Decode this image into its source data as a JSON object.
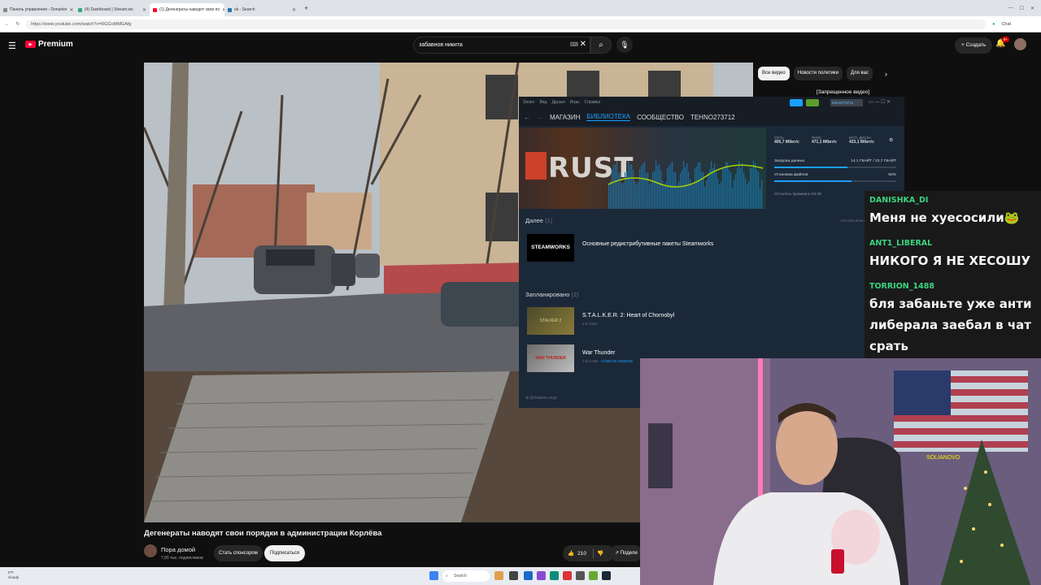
{
  "browser": {
    "tabs": [
      {
        "label": "Панель управления - Donation",
        "active": false
      },
      {
        "label": "(4) Dashboard | Stream.ws",
        "active": false
      },
      {
        "label": "(1) Дегенераты наводят свои по",
        "active": true
      },
      {
        "label": "ok - Search",
        "active": false
      }
    ],
    "new_tab": "+",
    "url": "https://www.youtube.com/watch?v=RGGo8tMGAfg",
    "profile": "Chat"
  },
  "youtube": {
    "logo_text": "Premium",
    "search_value": "забавнов никита",
    "create_label": "Создать",
    "notifications_count": "9+",
    "chips": [
      "Все видео",
      "Новости политики",
      "Для вас"
    ],
    "rec_item_title": "[Запрещенное видео]",
    "video_title": "Дегенераты наводят свои порядки в администрации Корлёва",
    "channel_name": "Пора домой",
    "channel_subs": "7,65 тыс. подписчиков",
    "sponsor_label": "Стать спонсором",
    "subscribe_label": "Подписаться",
    "like_count": "210",
    "share_label": "Подели"
  },
  "steam": {
    "menu": [
      "Steam",
      "Вид",
      "Друзья",
      "Игры",
      "Справка"
    ],
    "nav": [
      "МАГАЗИН",
      "БИБЛИОТЕКА",
      "СООБЩЕСТВО",
      "TEHNO273712"
    ],
    "active_nav": "БИБЛИОТЕКА",
    "username": "tehno273712",
    "banner_game": "RUST",
    "stats": {
      "net_label": "СЕТЬ",
      "net_value": "405,7 Мбит/с",
      "peak_label": "ПИКС",
      "peak_value": "471,1 Мбит/с",
      "disk_label": "ИСП. ДИСКА",
      "disk_value": "433,1 Мбит/с",
      "download_label": "Загрузка данных",
      "download_value": "14,1 ГБАЙТ / 23,7 ГБАЙТ",
      "install_label": "Установка файлов",
      "install_value": "63%",
      "remaining_label": "Осталось примерно 04:36",
      "download_progress": 0.6,
      "install_progress": 0.63
    },
    "section_next": "Далее",
    "section_next_count": "(1)",
    "auto_label": "Автообновление",
    "next_item": {
      "thumb": "STEAMWORKS",
      "name": "Основные редистрибутивные пакеты Steamworks"
    },
    "section_planned": "Запланировано",
    "section_planned_count": "(2)",
    "planned_items": [
      {
        "name": "S.T.A.L.K.E.R. 2: Heart of Chornobyl",
        "sub": "9,9 гбайт",
        "thumb": "STALKER 2"
      },
      {
        "name": "War Thunder",
        "sub": "143,2 МБ",
        "sub2": "СПИСОК ИЗМЕНЕ",
        "thumb": "WAR THUNDER"
      }
    ],
    "add_game": "Добавить игру"
  },
  "chat": {
    "messages": [
      {
        "user": "DANISHKA_DI",
        "text": "Меня не хуесосили🐸"
      },
      {
        "user": "ANT1_LIBERAL",
        "text": "НИКОГО Я НЕ ХЕСОШУ"
      },
      {
        "user": "TORRION_1488",
        "text": "бля забаньте уже анти либерала заебал в чат срать"
      }
    ]
  },
  "taskbar": {
    "weather": "5°F",
    "weather_sub": "cloudy",
    "search_label": "Search"
  },
  "webcam": {
    "neon_sign": "SOLIANOVO"
  },
  "colors": {
    "youtube_red": "#ff0033",
    "steam_bg": "#1b2838",
    "steam_accent": "#1a9fff",
    "chat_user": "#3ddc84"
  }
}
